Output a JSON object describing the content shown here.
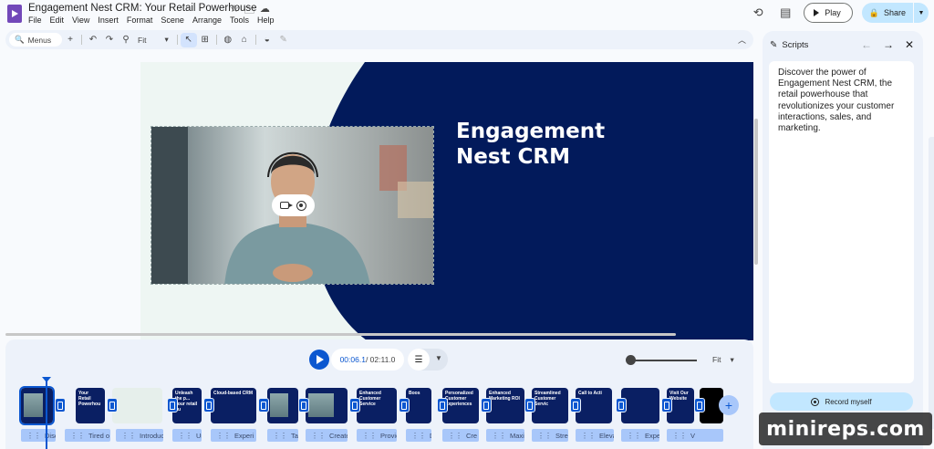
{
  "header": {
    "doc_title": "Engagement Nest CRM: Your Retail Powerhouse",
    "menu": [
      "File",
      "Edit",
      "View",
      "Insert",
      "Format",
      "Scene",
      "Arrange",
      "Tools",
      "Help"
    ],
    "play_label": "Play",
    "share_label": "Share"
  },
  "toolbar": {
    "search_placeholder": "Menus",
    "zoom_value": "Fit"
  },
  "slide": {
    "headline": "Engagement\nNest CRM"
  },
  "scripts": {
    "title": "Scripts",
    "text": "Discover the power of Engagement Nest CRM, the retail powerhouse that revolutionizes your customer interactions, sales, and marketing.",
    "record_label": "Record myself"
  },
  "playback": {
    "current_time": "00:06.1",
    "total_time": "/ 02:11.0",
    "fit_label": "Fit"
  },
  "scenes": [
    {
      "title": "",
      "style": "photo"
    },
    {
      "title": "Your Retail Powerhou",
      "style": "dark"
    },
    {
      "title": "",
      "style": "light"
    },
    {
      "title": "Unleash the p... your retail bu",
      "style": "dark"
    },
    {
      "title": "Cloud-based CRM",
      "style": "dark"
    },
    {
      "title": "",
      "style": "photo"
    },
    {
      "title": "",
      "style": "photo"
    },
    {
      "title": "Enhanced Customer Service",
      "style": "dark"
    },
    {
      "title": "Boos",
      "style": "dark"
    },
    {
      "title": "Personalized Customer Experiences",
      "style": "dark"
    },
    {
      "title": "Enhanced Marketing ROI",
      "style": "dark"
    },
    {
      "title": "Streamlined Customer Servic",
      "style": "dark"
    },
    {
      "title": "Call to Acti",
      "style": "dark"
    },
    {
      "title": "",
      "style": "dark"
    },
    {
      "title": "Visit Our Website",
      "style": "dark"
    },
    {
      "title": "",
      "style": "black"
    }
  ],
  "captions": [
    "Disco",
    "Tired o",
    "Introducin",
    "Un",
    "Experi",
    "Tak",
    "Create",
    "Provid",
    "Di",
    "Cre",
    "Maxim",
    "Stre",
    "Elevat",
    "Expe",
    "V"
  ],
  "colors": {
    "slide_navy": "#021a5b",
    "accent_blue": "#0b57d0",
    "slide_bg": "#eef6f3"
  }
}
